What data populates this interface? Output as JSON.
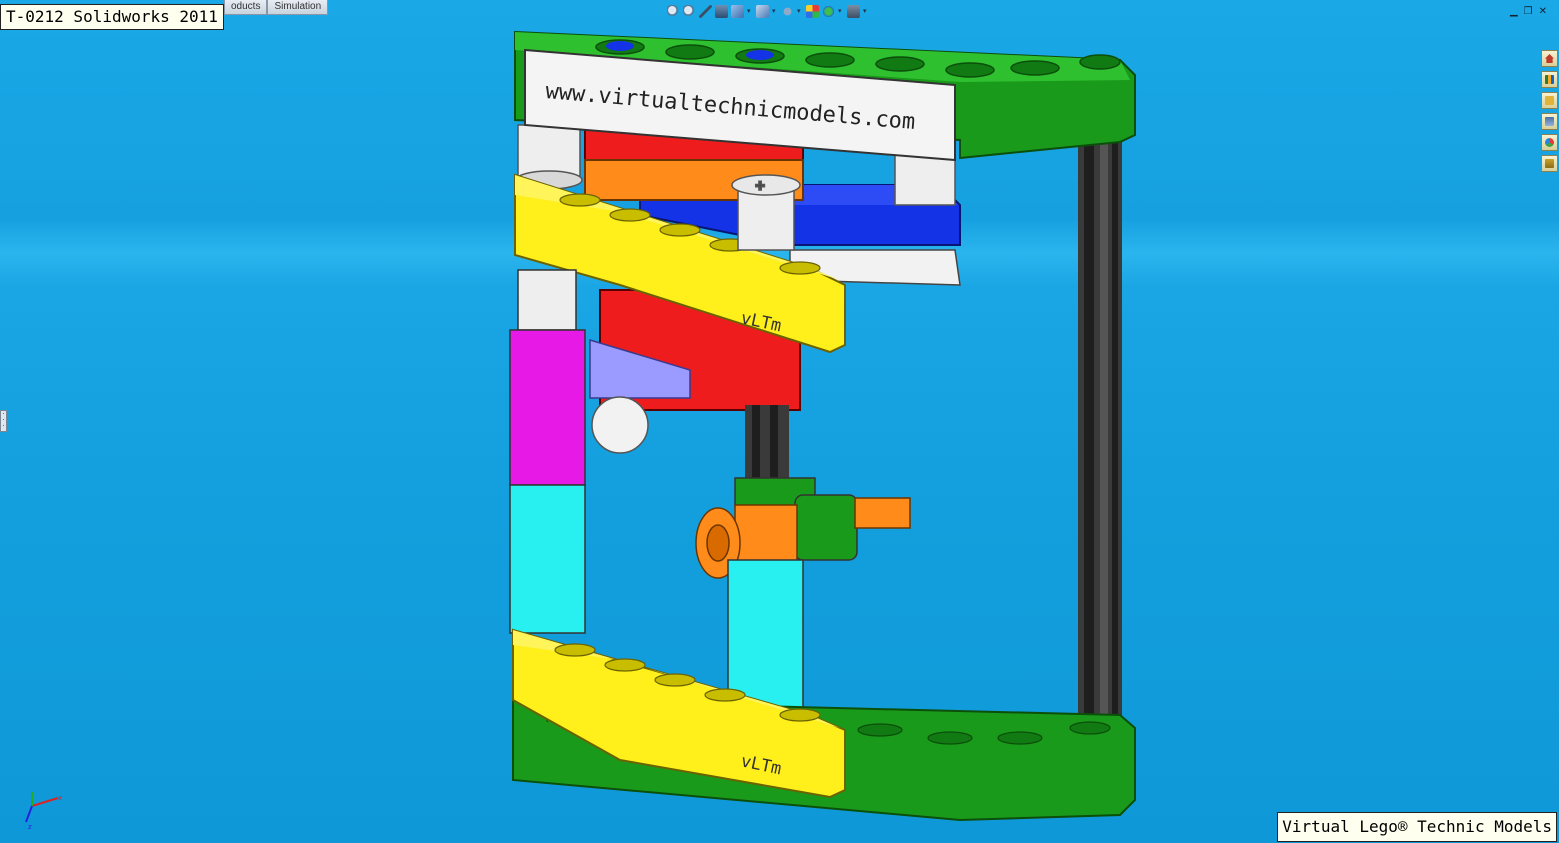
{
  "header": {
    "title": "T-0212 Solidworks 2011",
    "tabs": [
      "oducts",
      "Simulation"
    ]
  },
  "heads_up_toolbar": {
    "icons": [
      "zoom-to-fit-icon",
      "zoom-area-icon",
      "previous-view-icon",
      "section-view-icon",
      "view-orientation-icon",
      "display-style-icon",
      "hide-show-icon",
      "edit-appearance-icon",
      "apply-scene-icon",
      "view-settings-icon"
    ]
  },
  "task_pane": {
    "icons": [
      "home-icon",
      "design-library-icon",
      "file-explorer-icon",
      "view-palette-icon",
      "appearances-icon",
      "custom-properties-icon"
    ]
  },
  "model": {
    "banner_text": "www.virtualtechnicmodels.com",
    "beam_logo_top": "vLTm",
    "beam_logo_bottom": "vLTm",
    "small_logo": "vLTm"
  },
  "footer": {
    "watermark": "Virtual Lego® Technic Models"
  },
  "colors": {
    "background": "#16a0e0",
    "green": "#1a9a1a",
    "yellow": "#ffef1a",
    "red": "#ee1c1c",
    "orange": "#ff8c1a",
    "blue": "#1432e6",
    "magenta": "#e619e6",
    "cyan": "#28f0f0",
    "lavender": "#9a9aff",
    "dark-gray": "#3a3a3a",
    "white": "#f2f2f2"
  }
}
